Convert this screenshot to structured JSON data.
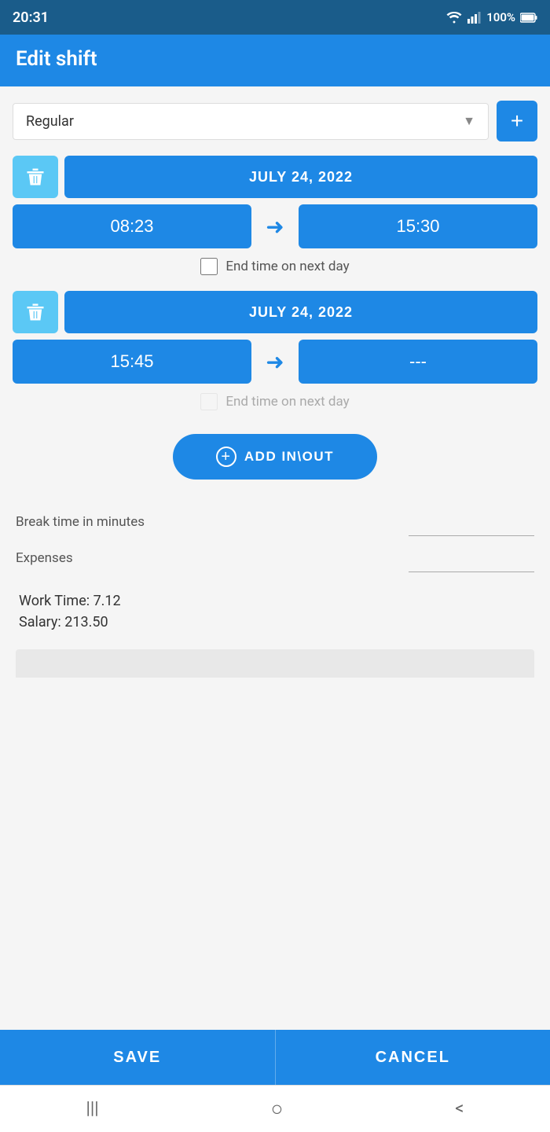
{
  "statusBar": {
    "time": "20:31",
    "battery": "100%"
  },
  "header": {
    "title": "Edit shift"
  },
  "shiftType": {
    "label": "Regular",
    "addButtonLabel": "+"
  },
  "shift1": {
    "date": "JULY 24, 2022",
    "startTime": "08:23",
    "endTime": "15:30",
    "endNextDay": false,
    "endNextDayLabel": "End time on next day"
  },
  "shift2": {
    "date": "JULY 24, 2022",
    "startTime": "15:45",
    "endTime": "---",
    "endNextDay": false,
    "endNextDayLabel": "End time on next day"
  },
  "addInOutButton": {
    "label": "ADD IN\\OUT"
  },
  "breakTime": {
    "label": "Break time in minutes",
    "value": ""
  },
  "expenses": {
    "label": "Expenses",
    "value": ""
  },
  "workTime": {
    "label": "Work Time: 7.12"
  },
  "salary": {
    "label": "Salary: 213.50"
  },
  "buttons": {
    "save": "SAVE",
    "cancel": "CANCEL"
  },
  "nav": {
    "menu": "|||",
    "home": "○",
    "back": "<"
  }
}
